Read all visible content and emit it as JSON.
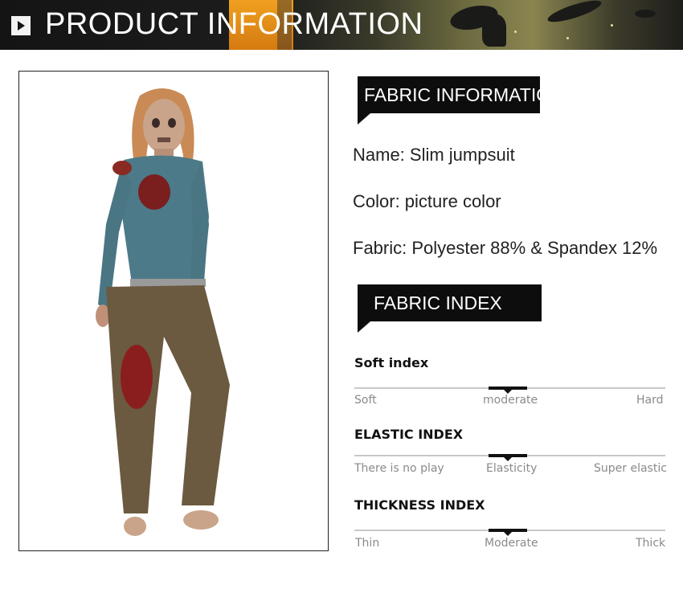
{
  "header": {
    "title": "PRODUCT INFORMATION"
  },
  "product_image": {
    "alt": "zombie-print-jumpsuit-model"
  },
  "fabric_information": {
    "tag": "FABRIC INFORMATION",
    "name": "Name:  Slim jumpsuit",
    "color": "Color:  picture color",
    "fabric": "Fabric: Polyester 88% & Spandex 12%"
  },
  "fabric_index": {
    "tag": "FABRIC INDEX",
    "soft": {
      "title": "Soft index",
      "labels": [
        "Soft",
        "moderate",
        "Hard"
      ],
      "level": 0.5
    },
    "elastic": {
      "title": "ELASTIC INDEX",
      "labels": [
        "There is no play",
        "Elasticity",
        "Super elastic"
      ],
      "level": 0.5
    },
    "thickness": {
      "title": "THICKNESS INDEX",
      "labels": [
        "Thin",
        "Moderate",
        "Thick"
      ],
      "level": 0.5
    }
  }
}
